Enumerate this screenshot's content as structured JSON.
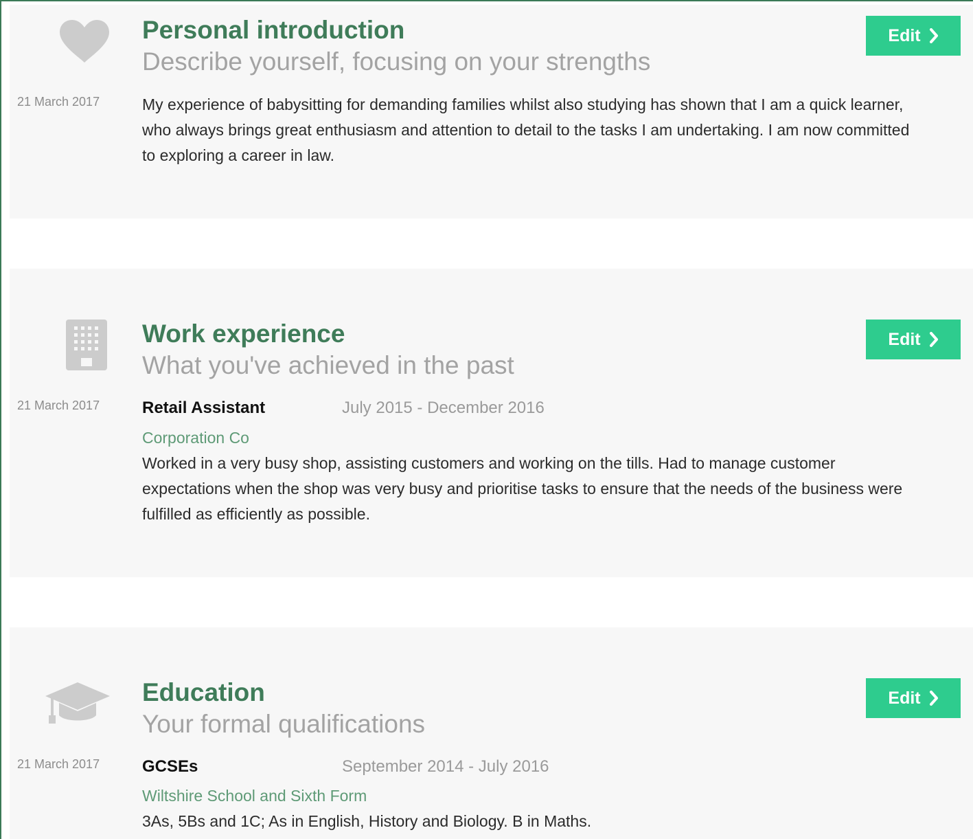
{
  "sections": [
    {
      "title": "Personal introduction",
      "subtitle": "Describe yourself, focusing on your strengths",
      "date": "21 March 2017",
      "edit_label": "Edit",
      "icon": "heart-icon",
      "body": "My experience of babysitting for demanding families whilst also studying has shown that I am a quick learner, who always brings great enthusiasm and attention to detail to the tasks I am undertaking. I am now committed to exploring a career in law."
    },
    {
      "title": "Work experience",
      "subtitle": "What you've achieved in the past",
      "date": "21 March 2017",
      "edit_label": "Edit",
      "icon": "building-icon",
      "role": "Retail Assistant",
      "period": "July 2015 - December 2016",
      "organisation": "Corporation Co",
      "body": "Worked in a very busy shop, assisting customers and working on the tills. Had to manage customer expectations when the shop was very busy and prioritise tasks to ensure that the needs of the business were fulfilled as efficiently as possible."
    },
    {
      "title": "Education",
      "subtitle": "Your formal qualifications",
      "date": "21 March 2017",
      "edit_label": "Edit",
      "icon": "graduation-cap-icon",
      "role": "GCSEs",
      "period": "September 2014 - July 2016",
      "organisation": "Wiltshire School and Sixth Form",
      "body": "3As, 5Bs and 1C; As in English, History and Biology. B in Maths."
    }
  ],
  "colors": {
    "accent_green": "#3f7c59",
    "button_green": "#2ecc8e",
    "org_green": "#5e9a76",
    "panel_bg": "#f7f7f7",
    "icon_grey": "#cccccc"
  }
}
